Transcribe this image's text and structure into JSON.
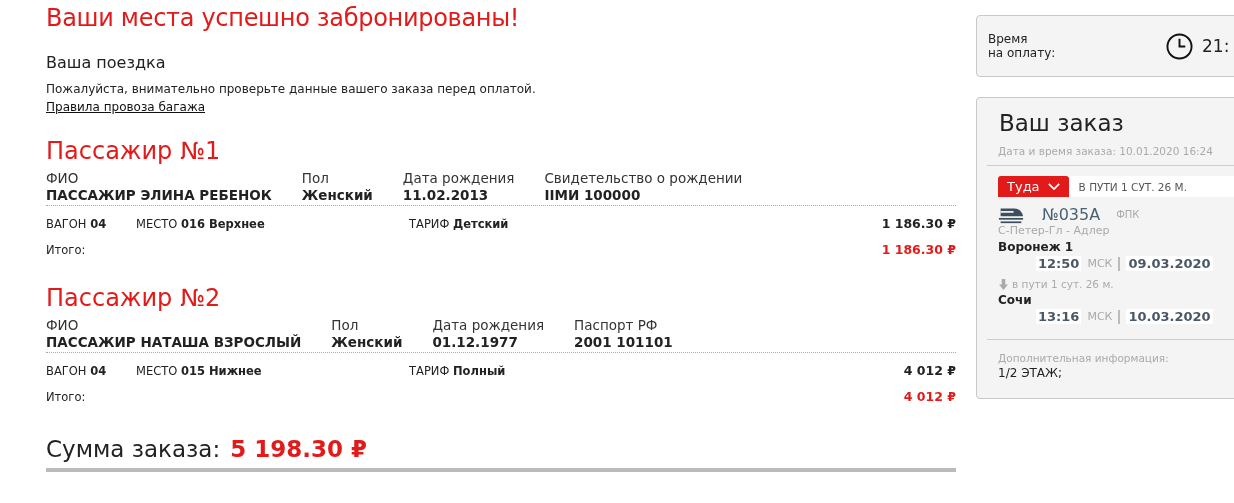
{
  "title": "Ваши места успешно забронированы!",
  "trip": {
    "heading": "Ваша поездка",
    "note": "Пожалуйста, внимательно проверьте данные вашего заказа перед оплатой.",
    "link": "Правила провоза багажа"
  },
  "passengers": [
    {
      "heading": "Пассажир №1",
      "fields": [
        {
          "label": "ФИО",
          "value": "ПАССАЖИР ЭЛИНА РЕБЕНОК"
        },
        {
          "label": "Пол",
          "value": "Женский"
        },
        {
          "label": "Дата рождения",
          "value": "11.02.2013"
        },
        {
          "label": "Свидетельство о рождении",
          "value": "IIМИ 100000"
        }
      ],
      "car": "ВАГОН **04**",
      "seat": "МЕСТО **016 Верхнее**",
      "tariff": "ТАРИФ **Детский**",
      "price": "1 186.30 ₽",
      "total_label": "Итого:",
      "total": "1 186.30 ₽"
    },
    {
      "heading": "Пассажир №2",
      "fields": [
        {
          "label": "ФИО",
          "value": "ПАССАЖИР НАТАША ВЗРОСЛЫЙ"
        },
        {
          "label": "Пол",
          "value": "Женский"
        },
        {
          "label": "Дата рождения",
          "value": "01.12.1977"
        },
        {
          "label": "Паспорт РФ",
          "value": "2001 101101"
        }
      ],
      "car": "ВАГОН **04**",
      "seat": "МЕСТО **015 Нижнее**",
      "tariff": "ТАРИФ **Полный**",
      "price": "4 012 ₽",
      "total_label": "Итого:",
      "total": "4 012 ₽"
    }
  ],
  "sum": {
    "label": "Сумма заказа:",
    "value": "5 198.30 ₽"
  },
  "timer": {
    "label_1": "Время",
    "label_2": "на оплату:",
    "value": "21:"
  },
  "order": {
    "title": "Ваш заказ",
    "date": "Дата и время заказа: 10.01.2020 16:24",
    "direction": "Туда",
    "duration": "В ПУТИ 1 СУТ.  26 М.",
    "train": "№035А",
    "carrier": "ФПК",
    "route": "С-Петер-Гл - Адлер",
    "from": {
      "station": "Воронеж 1",
      "time": "12:50",
      "zone": "МСК",
      "date": "09.03.2020"
    },
    "travel": "в пути  1 сут.  26 м.",
    "to": {
      "station": "Сочи",
      "time": "13:16",
      "zone": "МСК",
      "date": "10.03.2020"
    },
    "info_label": "Дополнительная информация:",
    "info": "1/2 ЭТАЖ;"
  }
}
